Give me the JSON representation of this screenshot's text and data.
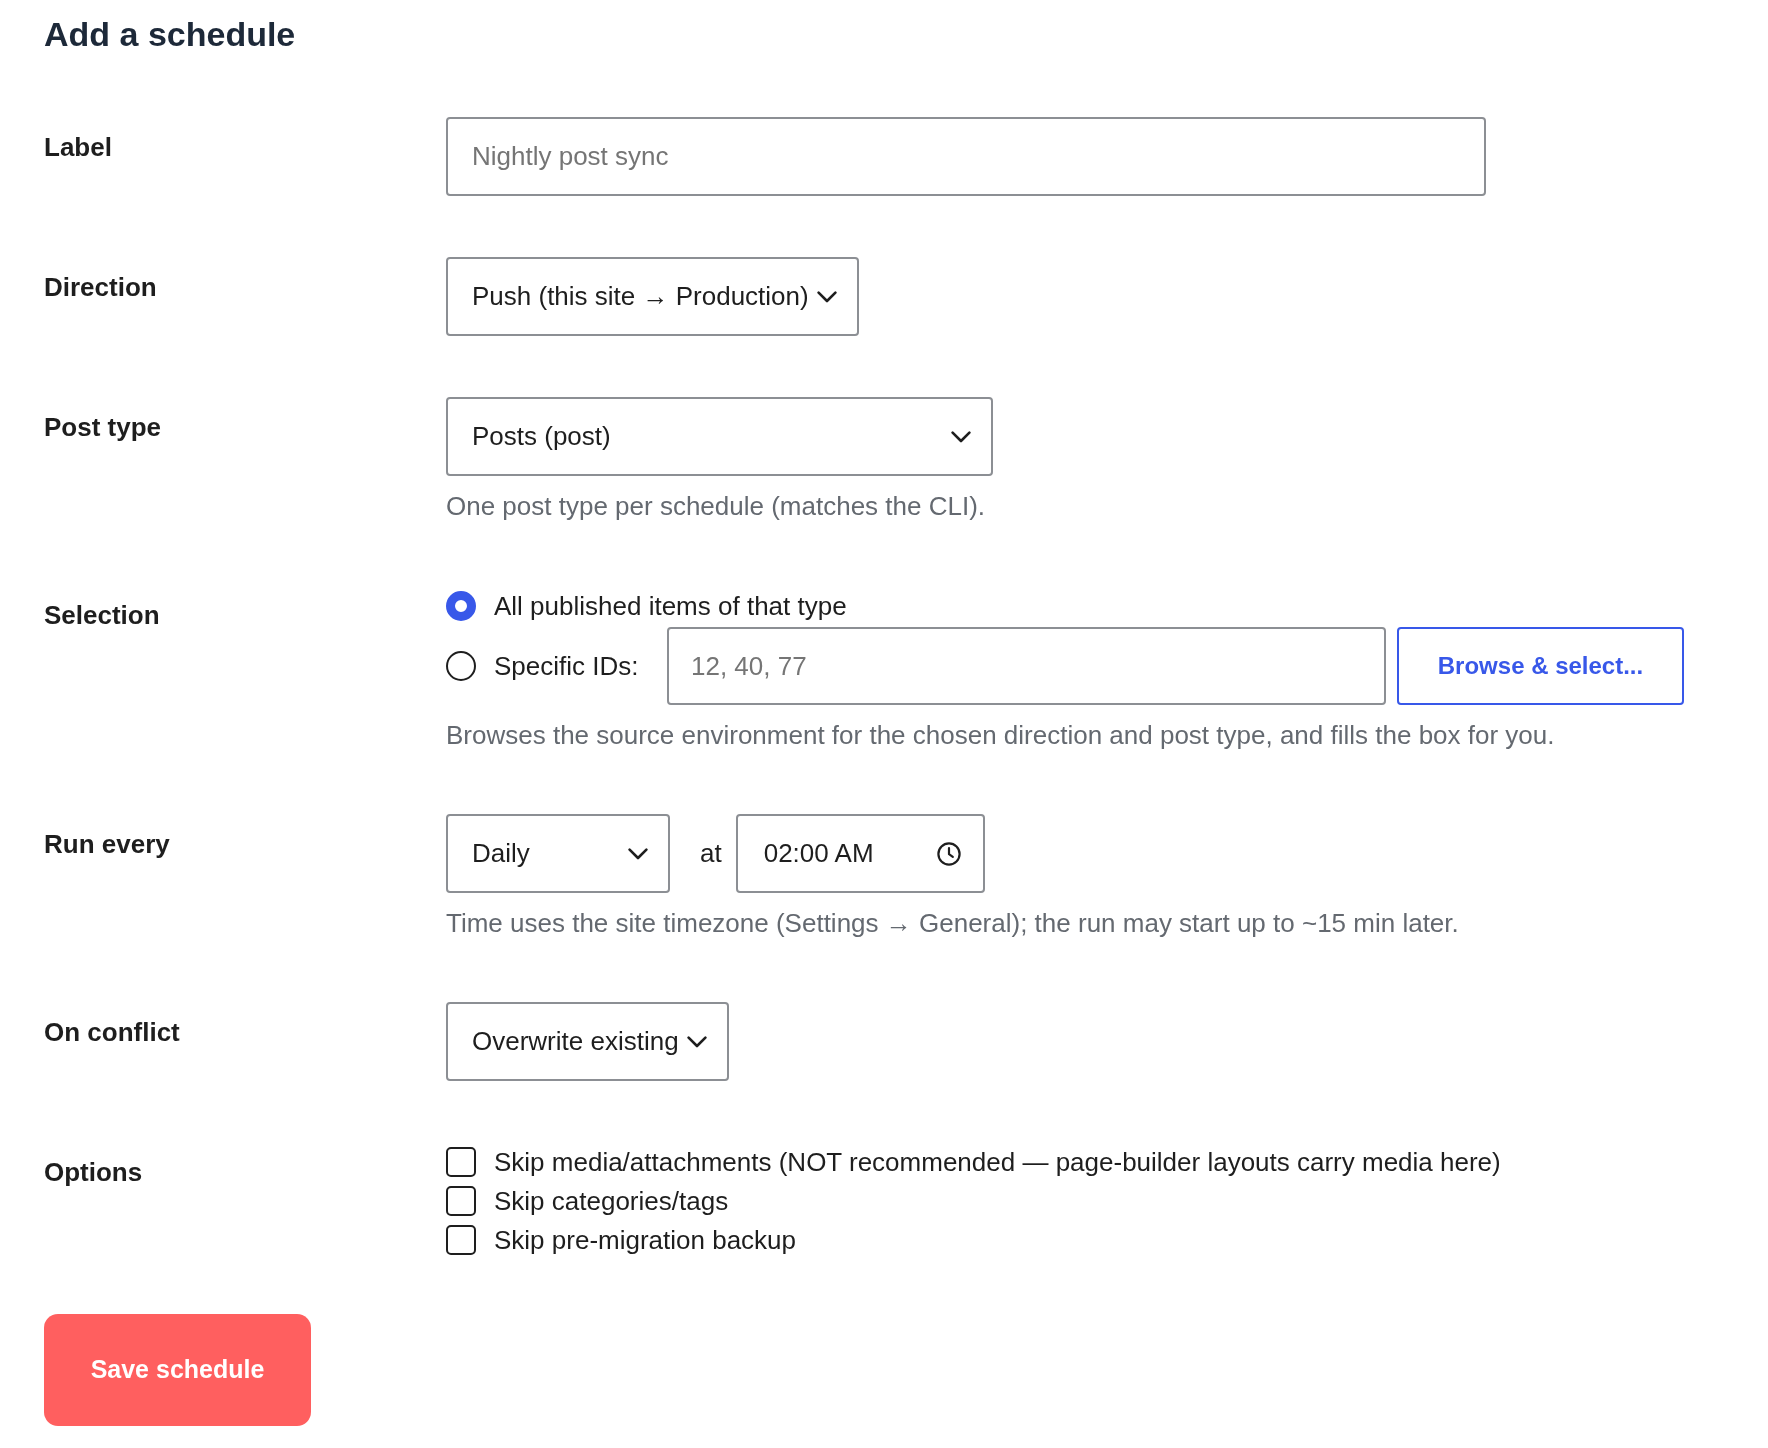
{
  "title": "Add a schedule",
  "fields": [
    {
      "kind": "text",
      "label": "Label",
      "placeholder": "Nightly post sync"
    },
    {
      "kind": "select",
      "label": "Direction",
      "value": "Push (this site → Production)"
    },
    {
      "kind": "select",
      "label": "Post type",
      "value": "Posts (post)",
      "help": "One post type per schedule (matches the CLI)."
    },
    {
      "kind": "selection",
      "label": "Selection",
      "options": [
        {
          "label": "All published items of that type",
          "selected": true
        },
        {
          "label": "Specific IDs:",
          "selected": false,
          "placeholder": "12, 40, 77",
          "button": "Browse & select..."
        }
      ],
      "help": "Browses the source environment for the chosen direction and post type, and fills the box for you."
    },
    {
      "kind": "schedule",
      "label": "Run every",
      "frequency": "Daily",
      "connector": "at",
      "time": "02:00 AM",
      "help": "Time uses the site timezone (Settings → General); the run may start up to ~15 min later."
    },
    {
      "kind": "select",
      "label": "On conflict",
      "value": "Overwrite existing"
    },
    {
      "kind": "checkboxes",
      "label": "Options",
      "items": [
        {
          "label": "Skip media/attachments (NOT recommended — page-builder layouts carry media here)",
          "checked": false
        },
        {
          "label": "Skip categories/tags",
          "checked": false
        },
        {
          "label": "Skip pre-migration backup",
          "checked": false
        }
      ]
    }
  ],
  "save_button": "Save schedule"
}
